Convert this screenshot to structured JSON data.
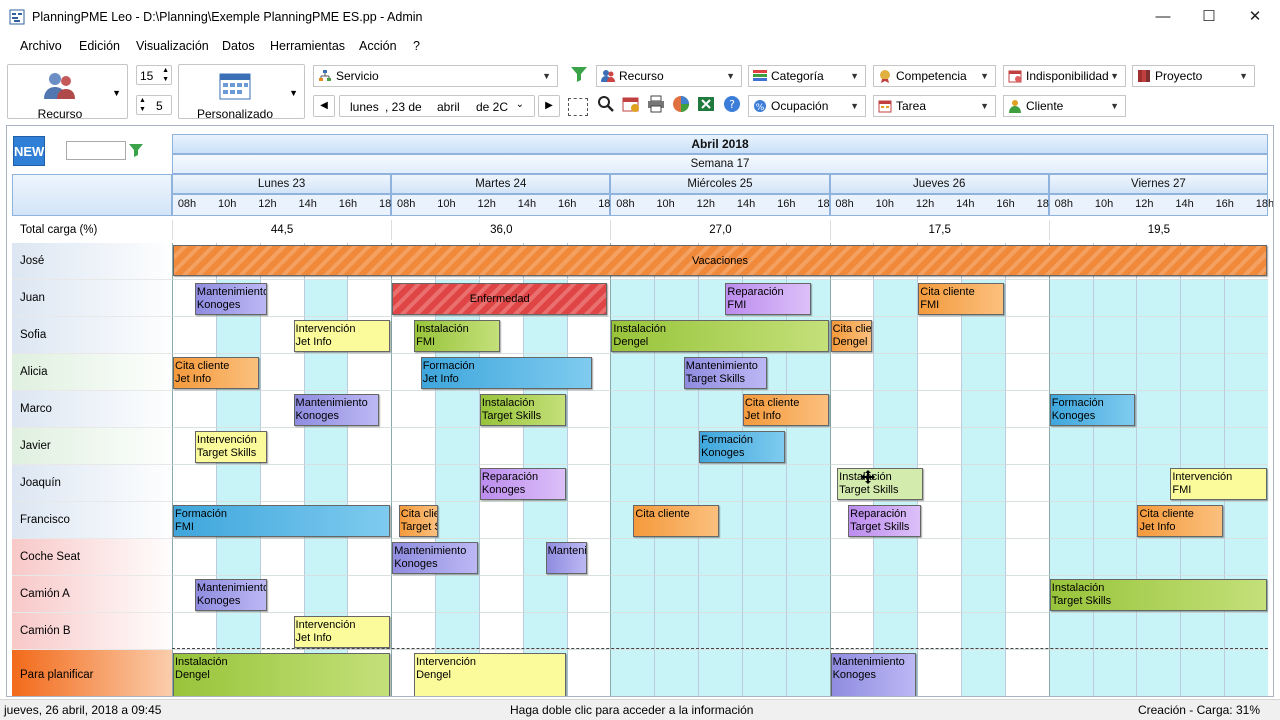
{
  "window": {
    "title": "PlanningPME Leo - D:\\Planning\\Exemple PlanningPME ES.pp - Admin",
    "minimize": "—",
    "maximize": "☐",
    "close": "✕"
  },
  "menu": [
    "Archivo",
    "Edición",
    "Visualización",
    "Datos",
    "Herramientas",
    "Acción",
    "?"
  ],
  "toolbar": {
    "resource_label": "Recurso",
    "days_value": "15",
    "rows_value": "5",
    "view_label": "Personalizado",
    "date_day": "lunes",
    "date_num": ", 23 de",
    "date_month": "abril",
    "date_year": "de 2C",
    "filters": {
      "servicio": "Servicio",
      "recurso": "Recurso",
      "categoria": "Categoría",
      "competencia": "Competencia",
      "indisponibilidad": "Indisponibilidad",
      "proyecto": "Proyecto",
      "ocupacion": "Ocupación",
      "tarea": "Tarea",
      "cliente": "Cliente"
    }
  },
  "grid": {
    "new_label": "NEW",
    "month": "Abril 2018",
    "week": "Semana 17",
    "days": [
      "Lunes 23",
      "Martes 24",
      "Miércoles 25",
      "Jueves 26",
      "Viernes 27"
    ],
    "hours": [
      "08h",
      "10h",
      "12h",
      "14h",
      "16h",
      "18h"
    ],
    "total_label": "Total carga (%)",
    "totals": [
      "44,5",
      "36,0",
      "27,0",
      "17,5",
      "19,5"
    ],
    "rows": [
      {
        "name": "José",
        "color": "#dce6f2"
      },
      {
        "name": "Juan",
        "color": "#dce6f2"
      },
      {
        "name": "Sofia",
        "color": "#dce6f2"
      },
      {
        "name": "Alicia",
        "color": "#dff0df"
      },
      {
        "name": "Marco",
        "color": "#dce6f2"
      },
      {
        "name": "Javier",
        "color": "#dff0df"
      },
      {
        "name": "Joaquín",
        "color": "#dce6f2"
      },
      {
        "name": "Francisco",
        "color": "#dce6f2"
      },
      {
        "name": "Coche Seat",
        "color": "#f8c8c8"
      },
      {
        "name": "Camión A",
        "color": "#f8c8c8"
      },
      {
        "name": "Camión B",
        "color": "#f8c8c8"
      },
      {
        "name": "Para planificar",
        "color": "#f4a070"
      }
    ],
    "tasks": [
      {
        "row": 0,
        "start": 0,
        "end": 5,
        "l1": "Vacaciones",
        "l2": "",
        "type": "vac"
      },
      {
        "row": 1,
        "start": 0.1,
        "end": 0.44,
        "l1": "Mantenimiento",
        "l2": "Konoges",
        "type": "purple"
      },
      {
        "row": 1,
        "start": 1,
        "end": 1.99,
        "l1": "Enfermedad",
        "l2": "",
        "type": "sick"
      },
      {
        "row": 1,
        "start": 2.52,
        "end": 2.92,
        "l1": "Reparación",
        "l2": "FMI",
        "type": "violet"
      },
      {
        "row": 1,
        "start": 3.4,
        "end": 3.8,
        "l1": "Cita cliente",
        "l2": "FMI",
        "type": "orange"
      },
      {
        "row": 2,
        "start": 0.55,
        "end": 1,
        "l1": "Intervención",
        "l2": "Jet Info",
        "type": "yellow"
      },
      {
        "row": 2,
        "start": 1.1,
        "end": 1.5,
        "l1": "Instalación",
        "l2": "FMI",
        "type": "green"
      },
      {
        "row": 2,
        "start": 2,
        "end": 3,
        "l1": "Instalación",
        "l2": "Dengel",
        "type": "green"
      },
      {
        "row": 2,
        "start": 3,
        "end": 3.2,
        "l1": "Cita clie",
        "l2": "Dengel",
        "type": "orange"
      },
      {
        "row": 3,
        "start": 0,
        "end": 0.4,
        "l1": "Cita cliente",
        "l2": "Jet Info",
        "type": "orange"
      },
      {
        "row": 3,
        "start": 1.13,
        "end": 1.92,
        "l1": "Formación",
        "l2": "Jet Info",
        "type": "blue"
      },
      {
        "row": 3,
        "start": 2.33,
        "end": 2.72,
        "l1": "Mantenimiento",
        "l2": "Target Skills",
        "type": "purple"
      },
      {
        "row": 4,
        "start": 0.55,
        "end": 0.95,
        "l1": "Mantenimiento",
        "l2": "Konoges",
        "type": "purple"
      },
      {
        "row": 4,
        "start": 1.4,
        "end": 1.8,
        "l1": "Instalación",
        "l2": "Target Skills",
        "type": "green"
      },
      {
        "row": 4,
        "start": 2.6,
        "end": 3,
        "l1": "Cita cliente",
        "l2": "Jet Info",
        "type": "orange"
      },
      {
        "row": 4,
        "start": 4,
        "end": 4.4,
        "l1": "Formación",
        "l2": "Konoges",
        "type": "blue"
      },
      {
        "row": 5,
        "start": 0.1,
        "end": 0.44,
        "l1": "Intervención",
        "l2": "Target Skills",
        "type": "yellow"
      },
      {
        "row": 5,
        "start": 2.4,
        "end": 2.8,
        "l1": "Formación",
        "l2": "Konoges",
        "type": "blue"
      },
      {
        "row": 6,
        "start": 1.4,
        "end": 1.8,
        "l1": "Reparación",
        "l2": "Konoges",
        "type": "violet"
      },
      {
        "row": 6,
        "start": 3.03,
        "end": 3.43,
        "l1": "Instalación",
        "l2": "Target Skills",
        "type": "greenlight"
      },
      {
        "row": 6,
        "start": 4.55,
        "end": 5,
        "l1": "Intervención",
        "l2": "FMI",
        "type": "yellow"
      },
      {
        "row": 7,
        "start": 0,
        "end": 1,
        "l1": "Formación",
        "l2": "FMI",
        "type": "blue"
      },
      {
        "row": 7,
        "start": 1.03,
        "end": 1.22,
        "l1": "Cita clier",
        "l2": "Target S",
        "type": "orange"
      },
      {
        "row": 7,
        "start": 2.1,
        "end": 2.5,
        "l1": "Cita cliente",
        "l2": "",
        "type": "orange"
      },
      {
        "row": 7,
        "start": 3.08,
        "end": 3.42,
        "l1": "Reparación",
        "l2": "Target Skills",
        "type": "violet"
      },
      {
        "row": 7,
        "start": 4.4,
        "end": 4.8,
        "l1": "Cita cliente",
        "l2": "Jet Info",
        "type": "orange"
      },
      {
        "row": 8,
        "start": 1,
        "end": 1.4,
        "l1": "Mantenimiento",
        "l2": "Konoges",
        "type": "purple"
      },
      {
        "row": 8,
        "start": 1.7,
        "end": 1.9,
        "l1": "Manteni",
        "l2": "",
        "type": "purple"
      },
      {
        "row": 9,
        "start": 0.1,
        "end": 0.44,
        "l1": "Mantenimiento",
        "l2": "Konoges",
        "type": "purple"
      },
      {
        "row": 9,
        "start": 4,
        "end": 5,
        "l1": "Instalación",
        "l2": "Target Skills",
        "type": "green"
      },
      {
        "row": 10,
        "start": 0.55,
        "end": 1,
        "l1": "Intervención",
        "l2": "Jet Info",
        "type": "yellow"
      },
      {
        "row": 11,
        "start": 0,
        "end": 1,
        "l1": "Instalación",
        "l2": "Dengel",
        "type": "green"
      },
      {
        "row": 11,
        "start": 1.1,
        "end": 1.8,
        "l1": "Intervención",
        "l2": "Dengel",
        "type": "yellow"
      },
      {
        "row": 11,
        "start": 3,
        "end": 3.4,
        "l1": "Mantenimiento",
        "l2": "Konoges",
        "type": "purple"
      }
    ]
  },
  "status": {
    "left": "jueves, 26 abril, 2018 a 09:45",
    "center": "Haga doble clic para acceder a la información",
    "right": "Creación - Carga: 31%"
  },
  "colors": {
    "yellow": "#fbfb9c",
    "green": "#a8cf45",
    "blue": "#45aee0",
    "purple": "#9b98e3",
    "violet": "#c59cf0",
    "orange": "#f6a44a",
    "sick": "#e04545",
    "vac": "#f08a3a",
    "greenlight": "#d4ebae"
  }
}
